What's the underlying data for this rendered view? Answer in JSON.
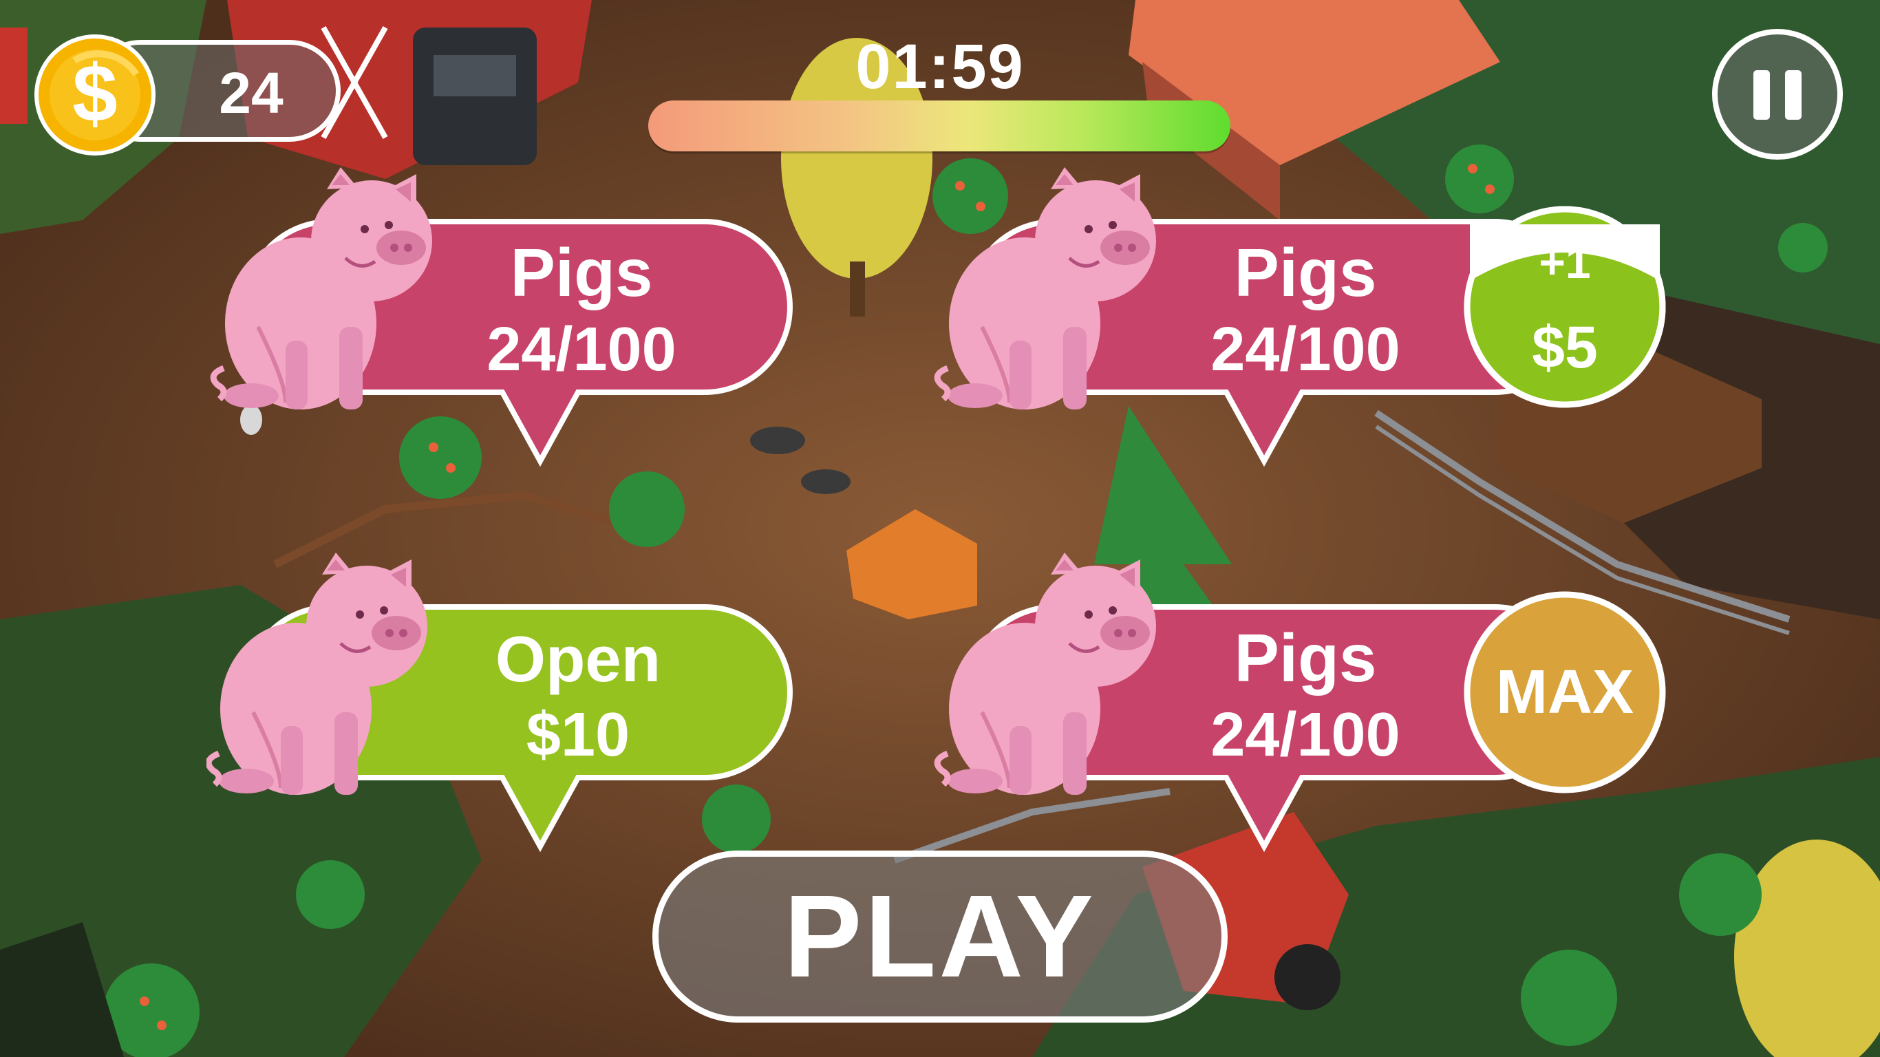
{
  "hud": {
    "coins": "24",
    "coin_symbol": "$",
    "timer": "01:59",
    "timer_progress": 1.0
  },
  "cards": [
    {
      "state": "active",
      "title": "Pigs",
      "count": "24/100"
    },
    {
      "state": "upgradable",
      "title": "Pigs",
      "count": "24/100",
      "badge_top": "+1",
      "badge_bottom": "$5"
    },
    {
      "state": "locked",
      "title": "Open",
      "price": "$10"
    },
    {
      "state": "maxed",
      "title": "Pigs",
      "count": "24/100",
      "badge": "MAX"
    }
  ],
  "play_button": {
    "label": "PLAY"
  },
  "colors": {
    "card_pink": "#c8436a",
    "card_green": "#96c21f",
    "badge_green": "#8cc21c",
    "badge_gold": "#d9a23a",
    "pig_pink": "#f3a6c4",
    "coin_gold": "#f6b400",
    "outline_white": "#ffffff"
  },
  "icons": [
    "dollar-coin-icon",
    "pause-icon",
    "pig-icon"
  ]
}
